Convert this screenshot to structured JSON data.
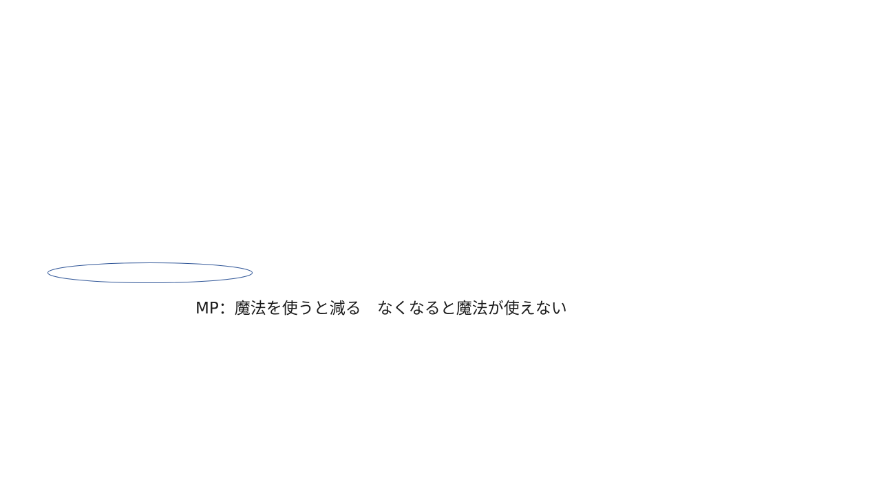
{
  "slide": {
    "caption": "MP：魔法を使うと減る　なくなると魔法が使えない",
    "ellipse_stroke_color": "#2f5597"
  }
}
